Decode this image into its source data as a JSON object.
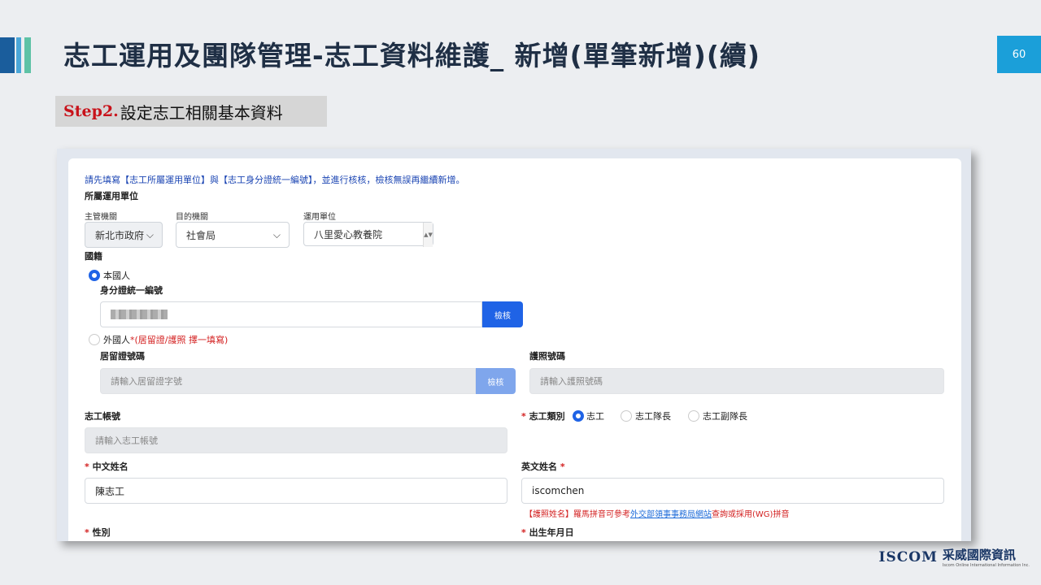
{
  "slide": {
    "title": "志工運用及團隊管理-志工資料維護_ 新增(單筆新增)(續)",
    "page_number": "60",
    "step_prefix": "Step2.",
    "step_text": "設定志工相關基本資料"
  },
  "form": {
    "notice": "請先填寫【志工所屬運用單位】與【志工身分證統一編號】，並進行核核，檢核無誤再繼續新增。",
    "unit_section_label": "所屬運用單位",
    "agency": {
      "label": "主管機關",
      "value": "新北市政府"
    },
    "target_agency": {
      "label": "目的機關",
      "value": "社會局"
    },
    "unit": {
      "label": "運用單位",
      "value": "八里愛心教養院"
    },
    "nationality_label": "國籍",
    "domestic": {
      "label": "本國人",
      "id_label": "身分證統一編號",
      "verify_button": "檢核",
      "selected": true
    },
    "foreign": {
      "label": "外國人",
      "note": "*(居留證/護照 擇一填寫)",
      "residence_label": "居留證號碼",
      "residence_placeholder": "請輸入居留證字號",
      "verify_button": "檢核",
      "passport_label": "護照號碼",
      "passport_placeholder": "請輸入護照號碼"
    },
    "account": {
      "label": "志工帳號",
      "placeholder": "請輸入志工帳號"
    },
    "volunteer_type": {
      "label": "志工類別",
      "options": [
        "志工",
        "志工隊長",
        "志工副隊長"
      ],
      "selected": "志工"
    },
    "chinese_name": {
      "label": "中文姓名",
      "value": "陳志工"
    },
    "english_name": {
      "label": "英文姓名",
      "value": "iscomchen"
    },
    "english_hint_pre": "【護照姓名】羅馬拼音可參考",
    "english_hint_link": "外交部領事事務局網站",
    "english_hint_post": "查詢或採用(WG)拼音",
    "gender": {
      "label": "性別"
    },
    "birthdate": {
      "label": "出生年月日"
    },
    "required_mark": "*"
  },
  "logo": {
    "word": "ISCOM",
    "cn": "采威國際資訊",
    "en": "Iscom Online International Information Inc."
  }
}
